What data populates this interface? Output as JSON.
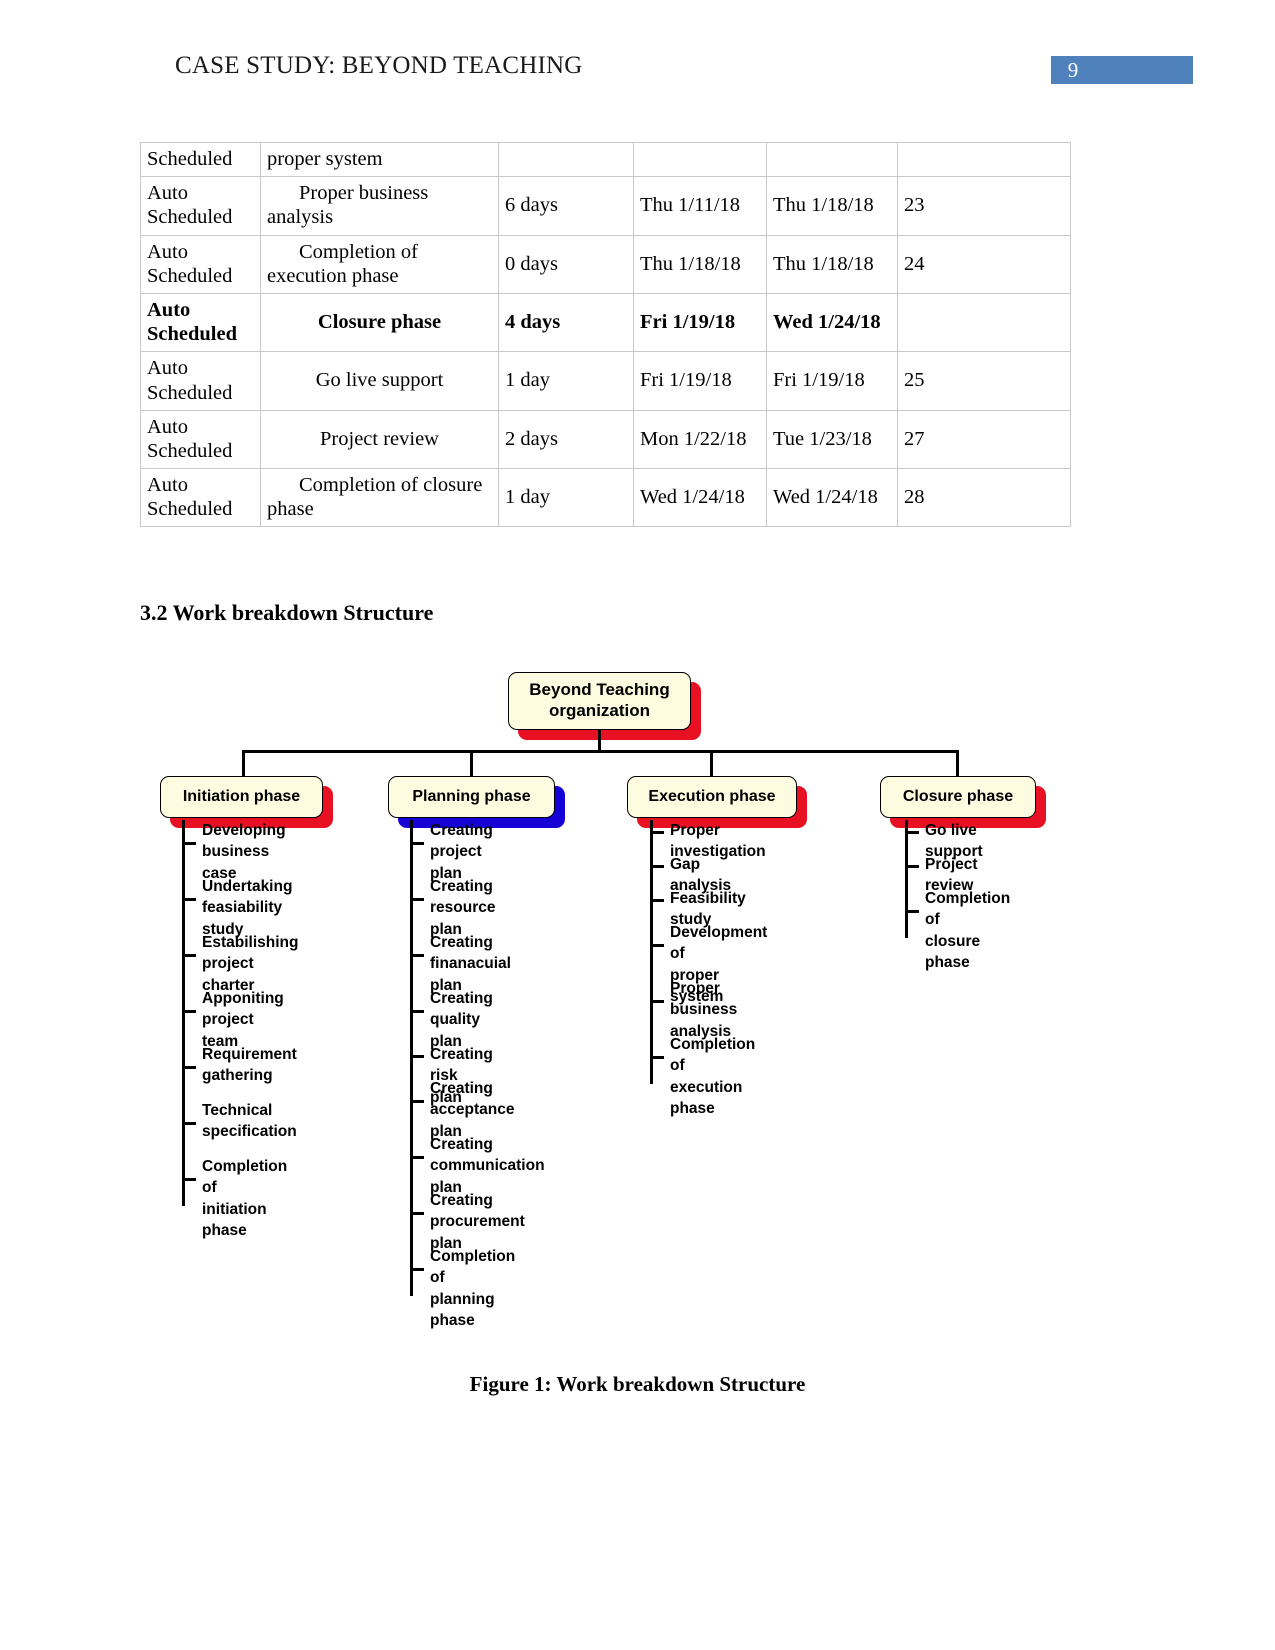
{
  "header": {
    "title": "CASE STUDY: BEYOND TEACHING",
    "page_number": "9",
    "badge_color": "#4f81bd"
  },
  "schedule_table": {
    "rows": [
      {
        "mode": "Scheduled",
        "name": "proper system",
        "duration": "",
        "start": "",
        "finish": "",
        "predecessors": "",
        "bold": false,
        "name_align": "left"
      },
      {
        "mode": "Auto Scheduled",
        "name": "Proper business analysis",
        "duration": "6 days",
        "start": "Thu 1/11/18",
        "finish": "Thu 1/18/18",
        "predecessors": "23",
        "bold": false,
        "name_align": "indent"
      },
      {
        "mode": "Auto Scheduled",
        "name": "Completion of execution phase",
        "duration": "0 days",
        "start": "Thu 1/18/18",
        "finish": "Thu 1/18/18",
        "predecessors": "24",
        "bold": false,
        "name_align": "indent"
      },
      {
        "mode": "Auto Scheduled",
        "name": "Closure phase",
        "duration": "4 days",
        "start": "Fri 1/19/18",
        "finish": "Wed 1/24/18",
        "predecessors": "",
        "bold": true,
        "name_align": "center"
      },
      {
        "mode": "Auto Scheduled",
        "name": "Go live support",
        "duration": "1 day",
        "start": "Fri 1/19/18",
        "finish": "Fri 1/19/18",
        "predecessors": "25",
        "bold": false,
        "name_align": "center"
      },
      {
        "mode": "Auto Scheduled",
        "name": "Project review",
        "duration": "2 days",
        "start": "Mon 1/22/18",
        "finish": "Tue 1/23/18",
        "predecessors": "27",
        "bold": false,
        "name_align": "center"
      },
      {
        "mode": "Auto Scheduled",
        "name": "Completion of closure phase",
        "duration": "1 day",
        "start": "Wed 1/24/18",
        "finish": "Wed 1/24/18",
        "predecessors": "28",
        "bold": false,
        "name_align": "indent"
      }
    ]
  },
  "section": {
    "heading": "3.2 Work breakdown Structure"
  },
  "wbs": {
    "root": {
      "label": "Beyond Teaching organization",
      "shadow_color": "#e81123"
    },
    "phases": [
      {
        "label": "Initiation phase",
        "shadow_color": "#e81123",
        "items": [
          "Developing\nbusiness case",
          "Undertaking\nfeasiability study",
          "Estabilishing\nproject charter",
          "Apponiting project\nteam",
          "Requirement\ngathering",
          "Technical\nspecification",
          "Completion of\ninitiation phase"
        ]
      },
      {
        "label": "Planning phase",
        "shadow_color": "#1500d6",
        "items": [
          "Creating project\nplan",
          "Creating resource\nplan",
          "Creating finanacuial\nplan",
          "Creating quality\nplan",
          "Creating risk plan",
          "Creating\nacceptance plan",
          "Creating\ncommunication plan",
          "Creating\nprocurement plan",
          "Completion of\nplanning phase"
        ]
      },
      {
        "label": "Execution phase",
        "shadow_color": "#e81123",
        "items": [
          "Proper investigation",
          "Gap analysis",
          "Feasibility study",
          "Development of\nproper system",
          "Proper business\nanalysis",
          "Completion of\nexecution phase"
        ]
      },
      {
        "label": "Closure phase",
        "shadow_color": "#e81123",
        "items": [
          "Go live support",
          "Project review",
          "Completion of\nclosure phase"
        ]
      }
    ],
    "box_fill": "#fdfbe0"
  },
  "figure": {
    "caption": "Figure 1: Work breakdown Structure"
  }
}
